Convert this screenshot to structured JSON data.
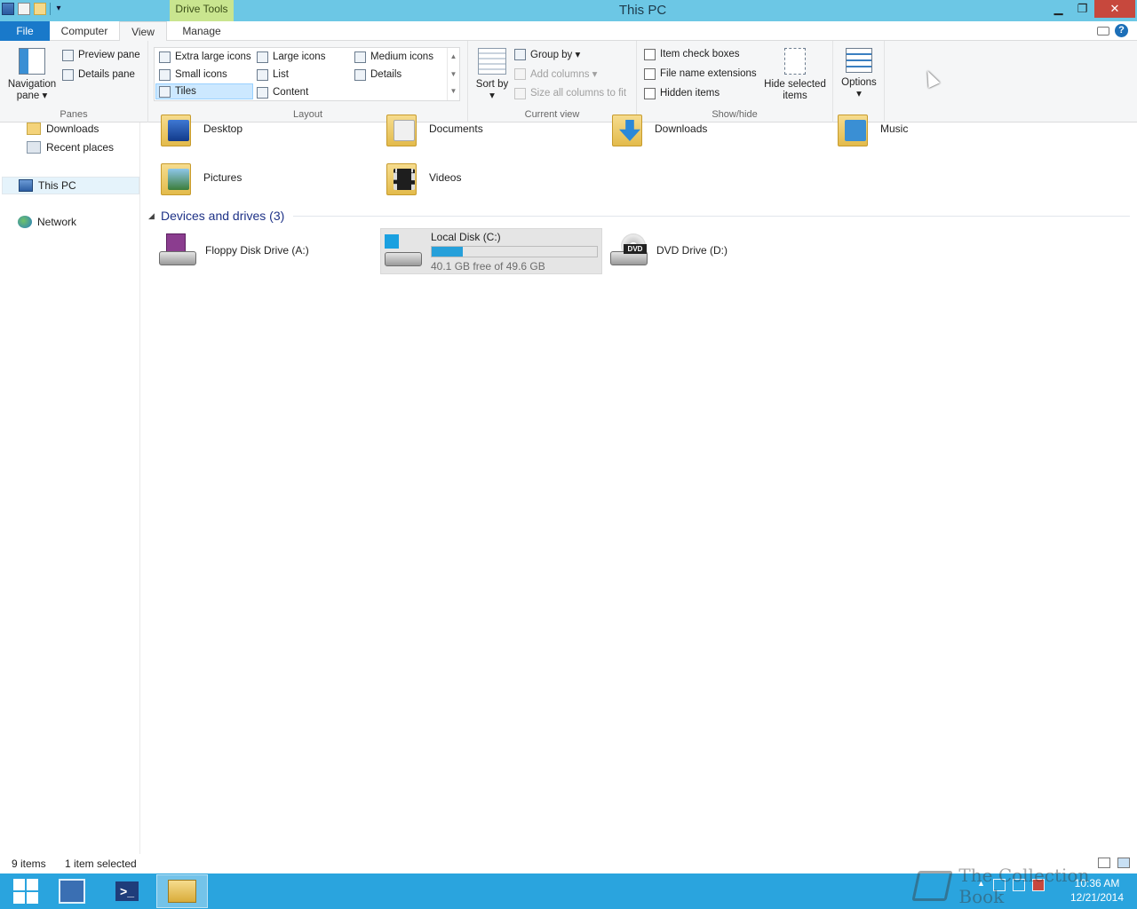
{
  "window": {
    "title": "This PC",
    "context_tab": "Drive Tools",
    "minimize": "▁",
    "maximize": "❐",
    "close": "✕"
  },
  "ribbon_tabs": {
    "file": "File",
    "computer": "Computer",
    "view": "View",
    "manage": "Manage",
    "help_glyph": "?"
  },
  "ribbon": {
    "panes": {
      "navigation_pane": "Navigation pane ▾",
      "preview_pane": "Preview pane",
      "details_pane": "Details pane",
      "label": "Panes"
    },
    "layout": {
      "items": [
        {
          "label": "Extra large icons",
          "icon": "extra-large-icons-icon"
        },
        {
          "label": "Large icons",
          "icon": "large-icons-icon"
        },
        {
          "label": "Medium icons",
          "icon": "medium-icons-icon"
        },
        {
          "label": "Small icons",
          "icon": "small-icons-icon"
        },
        {
          "label": "List",
          "icon": "list-icon"
        },
        {
          "label": "Details",
          "icon": "details-icon"
        },
        {
          "label": "Tiles",
          "icon": "tiles-icon",
          "selected": true
        },
        {
          "label": "Content",
          "icon": "content-icon"
        }
      ],
      "label": "Layout"
    },
    "current_view": {
      "sort_by": "Sort by ▾",
      "group_by": "Group by ▾",
      "add_columns": "Add columns ▾",
      "size_all_columns": "Size all columns to fit",
      "label": "Current view"
    },
    "show_hide": {
      "item_check_boxes": "Item check boxes",
      "file_name_extensions": "File name extensions",
      "hidden_items": "Hidden items",
      "hide_selected_items": "Hide selected items",
      "label": "Show/hide"
    },
    "options": {
      "label": "Options",
      "caret": "▾"
    }
  },
  "nav_pane": {
    "downloads": "Downloads",
    "recent_places": "Recent places",
    "this_pc": "This PC",
    "network": "Network"
  },
  "folders": [
    {
      "name": "Desktop",
      "icon": "desktop-folder-icon"
    },
    {
      "name": "Documents",
      "icon": "documents-folder-icon"
    },
    {
      "name": "Downloads",
      "icon": "downloads-folder-icon"
    },
    {
      "name": "Music",
      "icon": "music-folder-icon"
    },
    {
      "name": "Pictures",
      "icon": "pictures-folder-icon"
    },
    {
      "name": "Videos",
      "icon": "videos-folder-icon"
    }
  ],
  "devices_group": {
    "title": "Devices and drives (3)"
  },
  "drives": [
    {
      "name": "Floppy Disk Drive (A:)",
      "icon": "floppy-drive-icon"
    },
    {
      "name": "Local Disk (C:)",
      "icon": "local-disk-icon",
      "free_text": "40.1 GB free of 49.6 GB",
      "used_fraction": 0.19,
      "selected": true
    },
    {
      "name": "DVD Drive (D:)",
      "icon": "dvd-drive-icon",
      "badge": "DVD"
    }
  ],
  "status": {
    "item_count": "9 items",
    "selection": "1 item selected"
  },
  "taskbar": {
    "ps_glyph": ">_",
    "clock_time": "10:36 AM",
    "clock_date": "12/21/2014"
  },
  "watermark": "The Collection Book",
  "colors": {
    "titlebar": "#6cc7e5",
    "context_tab": "#c9e58f",
    "file_tab": "#1979ca",
    "taskbar": "#2aa4de",
    "usage_bar": "#26a0da",
    "group_header": "#1e3287"
  }
}
